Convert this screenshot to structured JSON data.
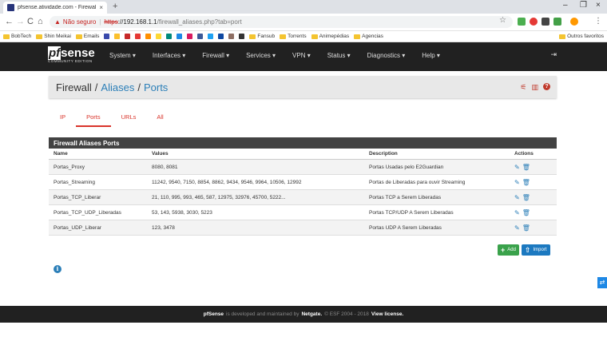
{
  "browser": {
    "tab_title": "pfsense.atividade.com - Firewall",
    "tab_close": "×",
    "new_tab": "+",
    "win_min": "–",
    "win_max": "❐",
    "win_close": "×",
    "not_secure": "Não seguro",
    "separator": "|",
    "url_scheme": "https",
    "url_host": "://192.168.1.1",
    "url_path": "/firewall_aliases.php?tab=port",
    "nav_back": "←",
    "nav_forward": "→",
    "reload": "C",
    "home": "⌂",
    "star": "☆",
    "menu": "⋮"
  },
  "bookmarks": {
    "items": [
      "BobTech",
      "Shin Meikai",
      "Emails",
      "Fansub",
      "Torrents",
      "Animepédias",
      "Agencias"
    ],
    "other": "Outros favoritos"
  },
  "navbar": {
    "logo_pf": "pf",
    "logo_sense": "sense",
    "logo_edition": "COMMUNITY EDITION",
    "menu": [
      "System ▾",
      "Interfaces ▾",
      "Firewall ▾",
      "Services ▾",
      "VPN ▾",
      "Status ▾",
      "Diagnostics ▾",
      "Help ▾"
    ],
    "logout": "⇥"
  },
  "breadcrumb": {
    "root": "Firewall",
    "sep1": "/",
    "level1": "Aliases",
    "sep2": "/",
    "level2": "Ports",
    "icons": {
      "filter": "⚟",
      "chart": "▥",
      "help": "?"
    }
  },
  "tabs": [
    "IP",
    "Ports",
    "URLs",
    "All"
  ],
  "active_tab": "Ports",
  "table": {
    "heading": "Firewall Aliases Ports",
    "columns": [
      "Name",
      "Values",
      "Description",
      "Actions"
    ],
    "rows": [
      {
        "name": "Portas_Proxy",
        "values": "8080, 8081",
        "description": "Portas Usadas pelo E2Guardian"
      },
      {
        "name": "Portas_Streaming",
        "values": "11242, 9540, 7150, 8854, 8862, 9434, 9546, 9964, 10506, 12992",
        "description": "Portas de Liberadas para ouvir Streaming"
      },
      {
        "name": "Portas_TCP_Liberar",
        "values": "21, 110, 995, 993, 465, 587, 12975, 32976, 45700, 5222...",
        "description": "Portas TCP a Serem Liberadas"
      },
      {
        "name": "Portas_TCP_UDP_Liberadas",
        "values": "53, 143, 5938, 3030, 5223",
        "description": "Portas TCP/UDP A Serem Liberadas"
      },
      {
        "name": "Portas_UDP_Liberar",
        "values": "123, 3478",
        "description": "Portas UDP A Serem Liberadas"
      }
    ],
    "edit_icon": "✎",
    "delete_icon": "🗑"
  },
  "buttons": {
    "add_icon": "+",
    "add": "Add",
    "import_icon": "⇧",
    "import": "Import"
  },
  "info_icon": "i",
  "side_widget": "⇄",
  "footer": {
    "brand": "pfSense",
    "text1": "is developed and maintained by",
    "company": "Netgate.",
    "text2": "© ESF 2004 - 2018",
    "license": "View license."
  },
  "colors": {
    "navbar": "#212121",
    "accent_red": "#d9342b",
    "link_blue": "#2c7fb8",
    "add_green": "#3aa24b",
    "import_blue": "#1c79c0"
  }
}
